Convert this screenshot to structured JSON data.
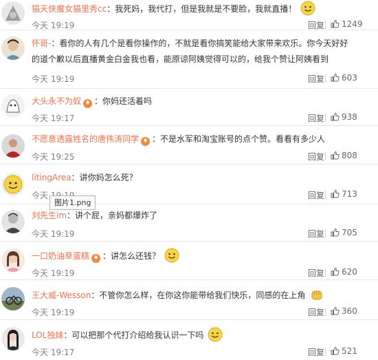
{
  "tooltip": "图片1.png",
  "reply_label": "回复",
  "comments": [
    {
      "user": "猫天侠魔女猫里秀cc",
      "text": "我死妈，我代打，但是我就是不要脸，我就直播！",
      "time": "今天 19:19",
      "likes": "1249"
    },
    {
      "user": "怀哥-",
      "text": "看你的人有几个是看你操作的，不就是看你搞笑能给大家带来欢乐。你今天好好",
      "text2": "的道个歉以后直播黄金白金我也看，能原谅阿姨觉得可以的，给我个赞让阿姨看到",
      "time": "今天 19:19",
      "likes": "603"
    },
    {
      "user": "大头永不为奴",
      "text": "你妈还活着吗",
      "time": "今天 19:17",
      "likes": "938"
    },
    {
      "user": "不愿意透露姓名的唐伟涛同学",
      "text": "不是水军和淘宝账号的点个赞。看看有多少人",
      "time": "今天 19:25",
      "likes": "808"
    },
    {
      "user": "litingArea",
      "text": "讲你妈怎么死？",
      "time": "今天 19:19",
      "likes": "713"
    },
    {
      "user": "刘先生im",
      "text": "讲个屁，亲妈都爆炸了",
      "time": "今天 19:19",
      "likes": "705"
    },
    {
      "user": "一口奶油草蛋糕",
      "text": "讲怎么还钱？",
      "time": "今天 19:19",
      "likes": "620"
    },
    {
      "user": "王大威-Wesson",
      "text": "不管你怎么样，在你这你能带给我们快乐，同感的在上角",
      "time": "今天 19:19",
      "likes": "360"
    },
    {
      "user": "LOL独妹",
      "text": "可以把那个代打介绍给我认识一下吗",
      "time": "今天 19:17",
      "likes": "521"
    }
  ]
}
